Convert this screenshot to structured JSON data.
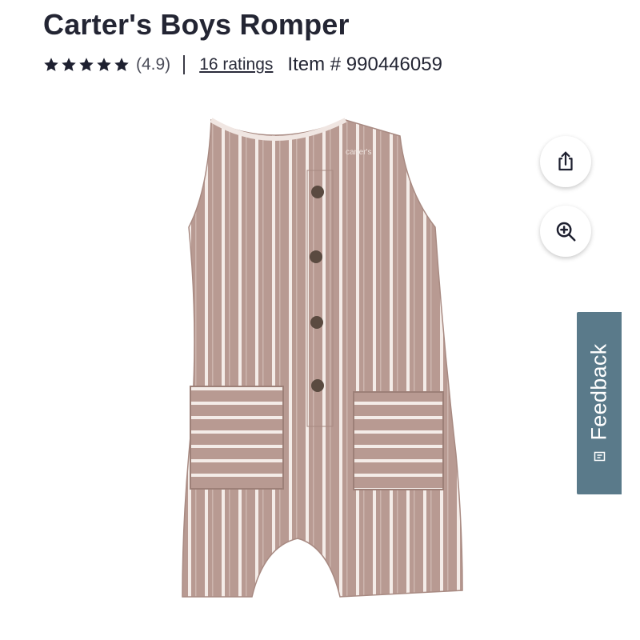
{
  "product": {
    "title": "Carter's Boys Romper",
    "rating_display": "(4.9)",
    "ratings_link": "16 ratings",
    "item_number": "Item # 990446059",
    "star_count": 5,
    "garment_label": "carter's"
  },
  "actions": {
    "share_icon": "share-icon",
    "zoom_icon": "zoom-in-icon"
  },
  "feedback": {
    "label": "Feedback",
    "icon": "feedback-icon"
  },
  "colors": {
    "title": "#232533",
    "feedback_tab": "#5a7a8a",
    "fabric": "#b89a92",
    "stripe": "#f4ece8"
  }
}
